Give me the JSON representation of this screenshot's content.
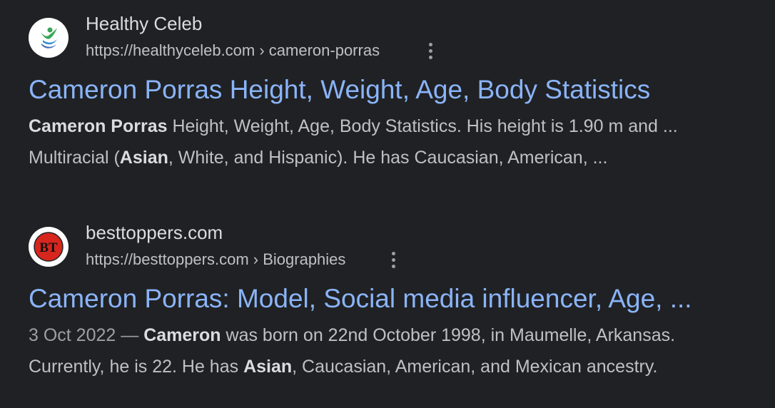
{
  "results": [
    {
      "site_name": "Healthy Celeb",
      "url": "https://healthyceleb.com › cameron-porras",
      "title": "Cameron Porras Height, Weight, Age, Body Statistics",
      "snippet_line1": {
        "bold1": "Cameron Porras",
        "rest": " Height, Weight, Age, Body Statistics. His height is 1.90 m and ..."
      },
      "snippet_line2": {
        "pre": "Multiracial (",
        "bold": "Asian",
        "post": ", White, and Hispanic). He has Caucasian, American, ..."
      },
      "favicon": "healthy-celeb-logo"
    },
    {
      "site_name": "besttoppers.com",
      "url": "https://besttoppers.com › Biographies",
      "title": "Cameron Porras: Model, Social media influencer, Age, ...",
      "date": "3 Oct 2022 — ",
      "snippet_line1": {
        "bold1": "Cameron",
        "rest": " was born on 22nd October 1998, in Maumelle, Arkansas."
      },
      "snippet_line2": {
        "pre": "Currently, he is 22. He has ",
        "bold": "Asian",
        "post": ", Caucasian, American, and Mexican ancestry."
      },
      "favicon": "bt-logo",
      "favicon_text": "BT"
    }
  ],
  "colors": {
    "background": "#202124",
    "link": "#8ab4f8",
    "text": "#bdc1c6",
    "site_name": "#dadce0",
    "bt_red": "#d7261e"
  }
}
